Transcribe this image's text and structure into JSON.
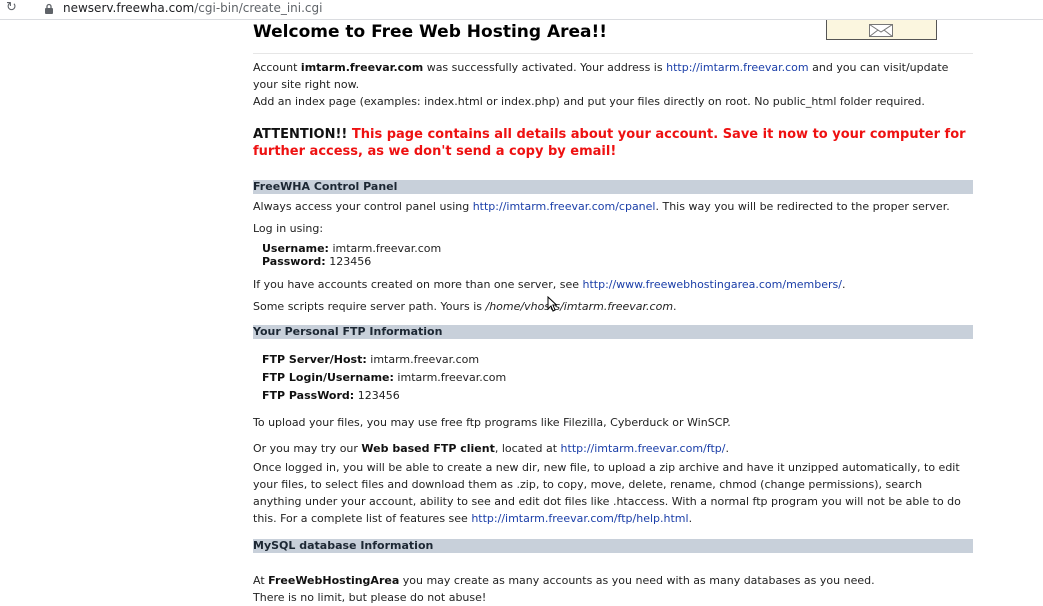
{
  "browser": {
    "url_host": "newserv.freewha.com",
    "url_path": "/cgi-bin/create_ini.cgi",
    "icons": {
      "reload": "reload-icon",
      "lock": "lock-icon"
    }
  },
  "header_banner": {
    "icon": "envelope-icon",
    "background": "#fbf6df"
  },
  "page": {
    "title": "Welcome to Free Web Hosting Area!!",
    "intro": {
      "account_prefix": "Account ",
      "account_name": "imtarm.freevar.com",
      "account_middle": " was successfully activated. Your address is ",
      "address_link": "http://imtarm.freevar.com",
      "account_suffix": " and you can visit/update your site right now.",
      "index_line": "Add an index page (examples: index.html or index.php) and put your files directly on root. No public_html folder required."
    },
    "attention": {
      "label": "ATTENTION!!",
      "message": " This page contains all details about your account. Save it now to your computer for further access, as we don't send a copy by email!",
      "color": "#ee1111"
    },
    "control_panel": {
      "header": "FreeWHA Control Panel",
      "access_prefix": "Always access your control panel using ",
      "access_link": "http://imtarm.freevar.com/cpanel",
      "access_suffix": ". This way you will be redirected to the proper server.",
      "login_intro": "Log in using:",
      "username_label": "Username:",
      "username_value": " imtarm.freevar.com",
      "password_label": "Password:",
      "password_value": " 123456",
      "multi_prefix": "If you have accounts created on more than one server, see ",
      "multi_link": "http://www.freewebhostingarea.com/members/",
      "multi_suffix": ".",
      "path_prefix": "Some scripts require server path. Yours is ",
      "path_value": "/home/vhosts/imtarm.freevar.com",
      "path_suffix": "."
    },
    "ftp": {
      "header": "Your Personal FTP Information",
      "server_label": "FTP Server/Host:",
      "server_value": " imtarm.freevar.com",
      "login_label": "FTP Login/Username:",
      "login_value": " imtarm.freevar.com",
      "password_label": "FTP PassWord:",
      "password_value": " 123456",
      "upload_text": "To upload your files, you may use free ftp programs like Filezilla, Cyberduck or WinSCP.",
      "web_prefix": "Or you may try our ",
      "web_bold": "Web based FTP client",
      "web_middle": ", located at ",
      "web_link": "http://imtarm.freevar.com/ftp/",
      "web_suffix": ".",
      "features_text": "Once logged in, you will be able to create a new dir, new file, to upload a zip archive and have it unzipped automatically, to edit your files, to select files and download them as .zip, to copy, move, delete, rename, chmod (change permissions), search anything under your account, ability to see and edit dot files like .htaccess. With a normal ftp program you will not be able to do this. For a complete list of features see ",
      "features_link": "http://imtarm.freevar.com/ftp/help.html",
      "features_suffix": "."
    },
    "mysql": {
      "header": "MySQL database Information",
      "line1_prefix": "At ",
      "line1_bold": "FreeWebHostingArea",
      "line1_suffix": " you may create as many accounts as you need with as many databases as you need.",
      "line2": "There is no limit, but please do not abuse!"
    },
    "section_header_color": "#c8d0da",
    "link_color": "#1a3ea8"
  }
}
